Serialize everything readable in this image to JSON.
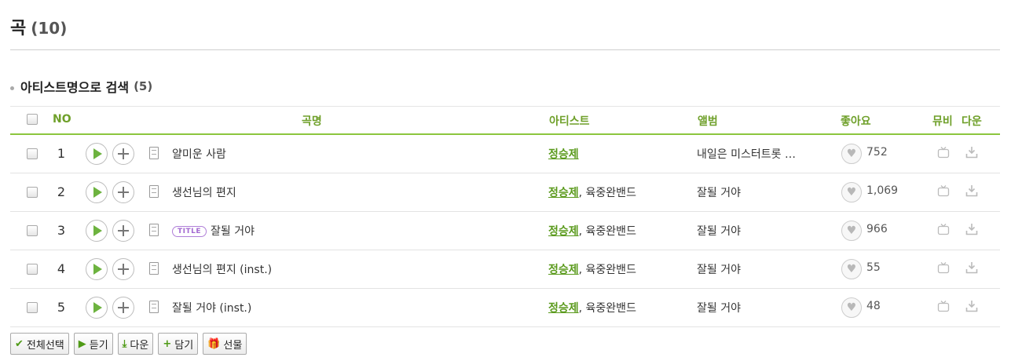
{
  "page": {
    "title": "곡",
    "title_count": "(10)"
  },
  "section": {
    "title": "아티스트명으로 검색",
    "count": "(5)"
  },
  "table": {
    "headers": {
      "no": "NO",
      "song": "곡명",
      "artist": "아티스트",
      "album": "앨범",
      "likes": "좋아요",
      "mv": "뮤비",
      "download": "다운"
    },
    "rows": [
      {
        "no": "1",
        "title": "얄미운 사람",
        "title_badge": "",
        "artist_main": "정승제",
        "artist_sep": "",
        "artist_sub": "",
        "album": "내일은 미스터트롯 …",
        "likes": "752"
      },
      {
        "no": "2",
        "title": "생선님의 편지",
        "title_badge": "",
        "artist_main": "정승제",
        "artist_sep": ",",
        "artist_sub": "육중완밴드",
        "album": "잘될 거야",
        "likes": "1,069"
      },
      {
        "no": "3",
        "title": "잘될 거야",
        "title_badge": "TITLE",
        "artist_main": "정승제",
        "artist_sep": ",",
        "artist_sub": "육중완밴드",
        "album": "잘될 거야",
        "likes": "966"
      },
      {
        "no": "4",
        "title": "생선님의 편지 (inst.)",
        "title_badge": "",
        "artist_main": "정승제",
        "artist_sep": ",",
        "artist_sub": "육중완밴드",
        "album": "잘될 거야",
        "likes": "55"
      },
      {
        "no": "5",
        "title": "잘될 거야 (inst.)",
        "title_badge": "",
        "artist_main": "정승제",
        "artist_sep": ",",
        "artist_sub": "육중완밴드",
        "album": "잘될 거야",
        "likes": "48"
      }
    ]
  },
  "actions": {
    "select_all": "전체선택",
    "listen": "듣기",
    "download": "다운",
    "add": "담기",
    "gift": "선물"
  },
  "colors": {
    "accent_green": "#6fa02a",
    "header_border": "#8cc63e",
    "artist_link": "#5a9a1c",
    "title_badge": "#a46bd2"
  },
  "icons": [
    "checkbox-icon",
    "play-icon",
    "add-icon",
    "lyrics-icon",
    "heart-icon",
    "mv-icon",
    "download-icon",
    "check-icon",
    "gift-icon"
  ]
}
